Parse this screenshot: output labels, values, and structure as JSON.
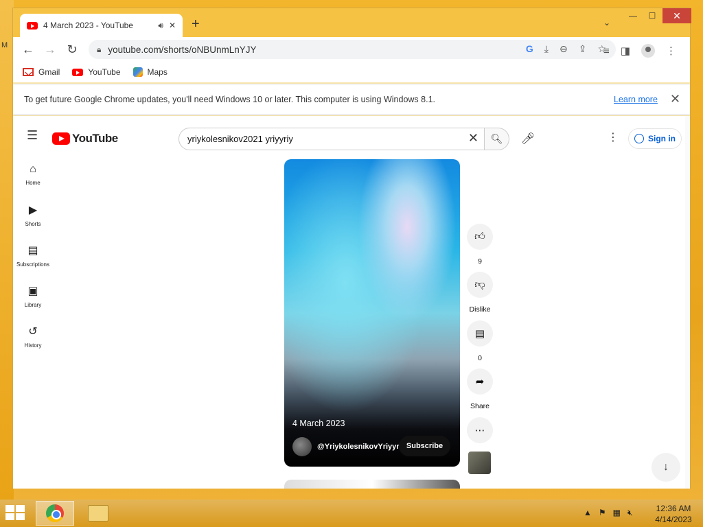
{
  "desktop": {
    "edge_label": "M"
  },
  "browser": {
    "tab": {
      "title": "4 March 2023 - YouTube",
      "audio_icon": "speaker-icon",
      "close": "✕"
    },
    "new_tab": "+",
    "tab_dropdown": "⌄",
    "window_controls": {
      "minimize": "—",
      "maximize": "☐",
      "close": "✕"
    },
    "nav": {
      "back": "←",
      "forward": "→",
      "reload": "↻"
    },
    "address": {
      "url": "youtube.com/shorts/oNBUnmLnYJY"
    },
    "bookmarks": [
      {
        "label": "Gmail",
        "icon": "gmail-icon"
      },
      {
        "label": "YouTube",
        "icon": "youtube-icon"
      },
      {
        "label": "Maps",
        "icon": "maps-icon"
      }
    ],
    "infobar": {
      "message": "To get future Google Chrome updates, you'll need Windows 10 or later. This computer is using Windows 8.1.",
      "learn_more": "Learn more",
      "close": "✕"
    }
  },
  "youtube": {
    "logo_text": "YouTube",
    "search": {
      "query": "yriykolesnikov2021 yriyyriy"
    },
    "sign_in": "Sign in",
    "guide": [
      {
        "label": "Home",
        "icon": "home-icon",
        "glyph": "⌂"
      },
      {
        "label": "Shorts",
        "icon": "shorts-icon",
        "glyph": "▶"
      },
      {
        "label": "Subscriptions",
        "icon": "subscriptions-icon",
        "glyph": "▤"
      },
      {
        "label": "Library",
        "icon": "library-icon",
        "glyph": "▣"
      },
      {
        "label": "History",
        "icon": "history-icon",
        "glyph": "↺"
      }
    ],
    "short": {
      "title": "4 March 2023",
      "channel": "@YriykolesnikovYriyyriy",
      "subscribe": "Subscribe"
    },
    "actions": {
      "like_count": "9",
      "dislike_label": "Dislike",
      "comments_count": "0",
      "share_label": "Share"
    }
  },
  "taskbar": {
    "time": "12:36 AM",
    "date": "4/14/2023"
  }
}
